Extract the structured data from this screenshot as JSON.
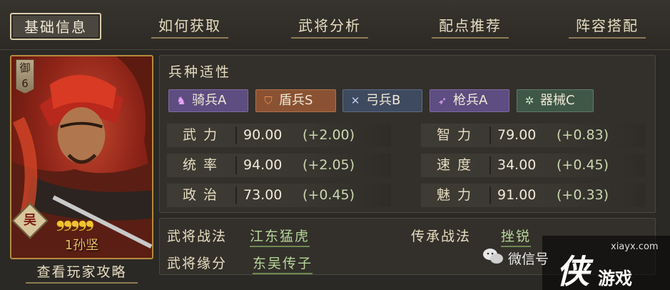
{
  "tabs": [
    {
      "label": "基础信息",
      "active": true
    },
    {
      "label": "如何获取",
      "active": false
    },
    {
      "label": "武将分析",
      "active": false
    },
    {
      "label": "配点推荐",
      "active": false
    },
    {
      "label": "阵容搭配",
      "active": false
    }
  ],
  "card": {
    "badge_char": "御",
    "badge_num": "6",
    "faction": "吴",
    "stars": 5,
    "stars_text": "❟❟❟❟❟",
    "name": "1孙坚"
  },
  "guide_link": "查看玩家攻略",
  "troops": {
    "section_title": "兵种适性",
    "items": [
      {
        "icon": "horse-icon",
        "label": "骑兵A",
        "color": "#5d4d80"
      },
      {
        "icon": "shield-icon",
        "label": "盾兵S",
        "color": "#8a5233"
      },
      {
        "icon": "bow-icon",
        "label": "弓兵B",
        "color": "#3e4a5f"
      },
      {
        "icon": "spear-icon",
        "label": "枪兵A",
        "color": "#5d4d80"
      },
      {
        "icon": "gear-icon",
        "label": "器械C",
        "color": "#3f5747"
      }
    ]
  },
  "stats": [
    {
      "label": "武力",
      "value": "90.00",
      "bonus": "(+2.00)"
    },
    {
      "label": "统率",
      "value": "94.00",
      "bonus": "(+2.05)"
    },
    {
      "label": "政治",
      "value": "73.00",
      "bonus": "(+0.45)"
    },
    {
      "label": "智力",
      "value": "79.00",
      "bonus": "(+0.83)"
    },
    {
      "label": "速度",
      "value": "34.00",
      "bonus": "(+0.45)"
    },
    {
      "label": "魅力",
      "value": "91.00",
      "bonus": "(+0.33)"
    }
  ],
  "skills": {
    "tactic_label": "武将战法",
    "tactic_value": "江东猛虎",
    "inherit_label": "传承战法",
    "inherit_value": "挫锐",
    "bond_label": "武将缘分",
    "bond_value": "东吴传子"
  },
  "watermark": {
    "site": "xiayx.com",
    "wechat_text": "微信号",
    "logo_main": "侠",
    "logo_sub": "游戏"
  }
}
